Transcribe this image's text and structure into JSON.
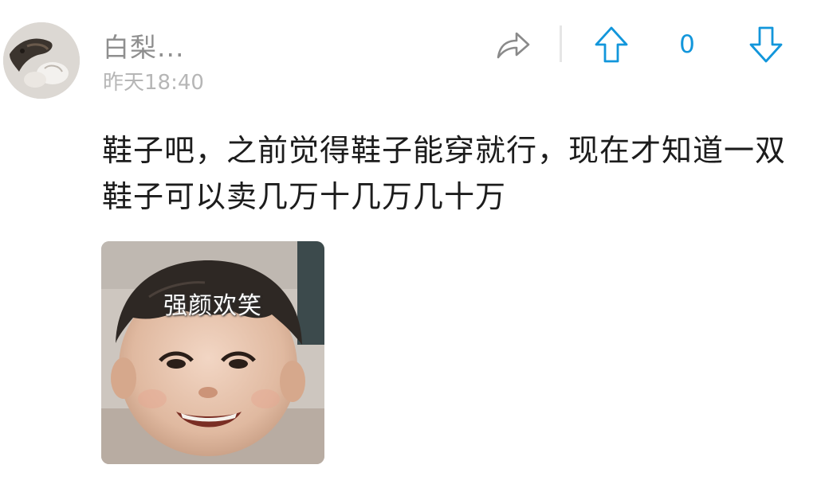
{
  "comment": {
    "author": "白梨...",
    "timestamp": "昨天18:40",
    "body": "鞋子吧，之前觉得鞋子能穿就行，现在才知道一双鞋子可以卖几万十几万几十万",
    "vote_count": "0",
    "meme": {
      "caption": "强颜欢笑"
    }
  },
  "actions": {
    "share_icon": "share-arrow-icon",
    "upvote_icon": "arrow-up-icon",
    "downvote_icon": "arrow-down-icon"
  },
  "colors": {
    "accent": "#1296db",
    "author_text": "#8f8f8f",
    "timestamp_text": "#b6b6b6",
    "body_text": "#1c1c1c"
  }
}
